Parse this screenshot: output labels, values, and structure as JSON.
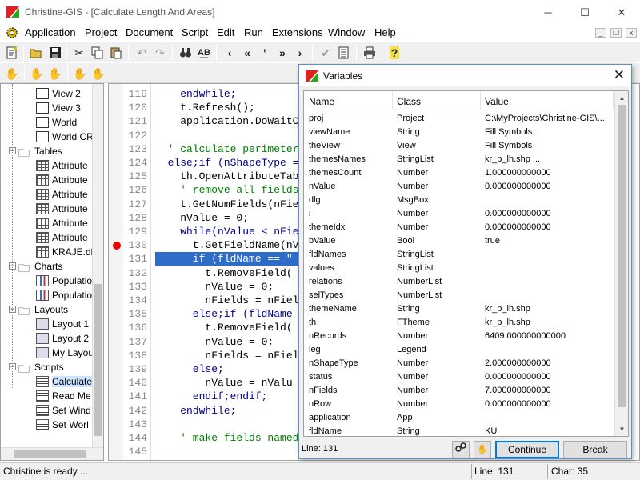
{
  "window": {
    "title": "Christine-GIS - [Calculate Length And Areas]",
    "minimize": "─",
    "maximize": "☐",
    "close": "✕"
  },
  "menu": {
    "items": [
      "Application",
      "Project",
      "Document",
      "Script",
      "Edit",
      "Run",
      "Extensions",
      "Window",
      "Help"
    ],
    "mdi_min": "_",
    "mdi_restore": "❐",
    "mdi_close": "x"
  },
  "toolbar1": {
    "icons": [
      "new-script-icon",
      "open-icon",
      "save-icon",
      "cut-icon",
      "copy-icon",
      "paste-icon",
      "undo-icon",
      "redo-icon",
      "find-icon",
      "replace-icon",
      "previous-icon",
      "first-icon",
      "quote-icon",
      "last-icon",
      "next-icon",
      "check-icon",
      "compile-icon",
      "print-icon",
      "help-icon"
    ]
  },
  "toolbar2": {
    "icons": [
      "hand-icon",
      "hand-step-icon",
      "hand-stop-icon",
      "hand-grid-icon",
      "hand-outline-icon"
    ]
  },
  "tree": {
    "rows": [
      {
        "label": "View 2",
        "icon": "doc"
      },
      {
        "label": "View 3",
        "icon": "doc"
      },
      {
        "label": "World",
        "icon": "doc"
      },
      {
        "label": "World CR",
        "icon": "doc"
      },
      {
        "label": "Tables",
        "icon": "folder"
      },
      {
        "label": "Attribute",
        "icon": "grid"
      },
      {
        "label": "Attribute",
        "icon": "grid"
      },
      {
        "label": "Attribute",
        "icon": "grid"
      },
      {
        "label": "Attribute",
        "icon": "grid"
      },
      {
        "label": "Attribute",
        "icon": "grid"
      },
      {
        "label": "Attribute",
        "icon": "grid"
      },
      {
        "label": "KRAJE.db",
        "icon": "grid"
      },
      {
        "label": "Charts",
        "icon": "folder"
      },
      {
        "label": "Populatio",
        "icon": "chart"
      },
      {
        "label": "Populatio",
        "icon": "chart"
      },
      {
        "label": "Layouts",
        "icon": "folder"
      },
      {
        "label": "Layout 1",
        "icon": "layout"
      },
      {
        "label": "Layout 2",
        "icon": "layout"
      },
      {
        "label": "My Layou",
        "icon": "layout"
      },
      {
        "label": "Scripts",
        "icon": "folder"
      },
      {
        "label": "Calculate",
        "icon": "script"
      },
      {
        "label": "Read Me",
        "icon": "script"
      },
      {
        "label": "Set Wind",
        "icon": "script"
      },
      {
        "label": "Set Worl",
        "icon": "script"
      }
    ]
  },
  "editor": {
    "lines": [
      {
        "n": "119",
        "text": "    endwhile;",
        "style": "kw"
      },
      {
        "n": "120",
        "text": "    t.Refresh();",
        "style": ""
      },
      {
        "n": "121",
        "text": "    application.DoWaitC",
        "style": ""
      },
      {
        "n": "122",
        "text": "",
        "style": ""
      },
      {
        "n": "123",
        "text": "  ' calculate perimeter",
        "style": "cm"
      },
      {
        "n": "124",
        "text": "  else;if (nShapeType =",
        "style": "kw"
      },
      {
        "n": "125",
        "text": "    th.OpenAttributeTab",
        "style": ""
      },
      {
        "n": "126",
        "text": "    ' remove all fields",
        "style": "cm"
      },
      {
        "n": "127",
        "text": "    t.GetNumFields(nFie",
        "style": ""
      },
      {
        "n": "128",
        "text": "    nValue = 0;",
        "style": ""
      },
      {
        "n": "129",
        "text": "    while(nValue < nFie",
        "style": "kw"
      },
      {
        "n": "130",
        "text": "      t.GetFieldName(nV",
        "style": ""
      },
      {
        "n": "131",
        "text": "      if (fldName == \"",
        "style": "hl"
      },
      {
        "n": "132",
        "text": "        t.RemoveField(",
        "style": ""
      },
      {
        "n": "133",
        "text": "        nValue = 0;",
        "style": ""
      },
      {
        "n": "134",
        "text": "        nFields = nFiel",
        "style": ""
      },
      {
        "n": "135",
        "text": "      else;if (fldName",
        "style": "kw"
      },
      {
        "n": "136",
        "text": "        t.RemoveField(",
        "style": ""
      },
      {
        "n": "137",
        "text": "        nValue = 0;",
        "style": ""
      },
      {
        "n": "138",
        "text": "        nFields = nFiel",
        "style": ""
      },
      {
        "n": "139",
        "text": "      else;",
        "style": "kw"
      },
      {
        "n": "140",
        "text": "        nValue = nValu",
        "style": ""
      },
      {
        "n": "141",
        "text": "      endif;endif;",
        "style": "kw"
      },
      {
        "n": "142",
        "text": "    endwhile;",
        "style": "kw"
      },
      {
        "n": "143",
        "text": "",
        "style": ""
      },
      {
        "n": "144",
        "text": "    ' make fields named",
        "style": "cm"
      },
      {
        "n": "145",
        "text": "",
        "style": ""
      }
    ],
    "breakpoint_line": "130"
  },
  "variables": {
    "title": "Variables",
    "close": "✕",
    "columns": [
      "Name",
      "Class",
      "Value"
    ],
    "rows": [
      [
        "proj",
        "Project",
        "C:\\MyProjects\\Christine-GIS\\..."
      ],
      [
        "viewName",
        "String",
        "Fill Symbols"
      ],
      [
        "theView",
        "View",
        "Fill Symbols"
      ],
      [
        "themesNames",
        "StringList",
        "kr_p_lh.shp ..."
      ],
      [
        "themesCount",
        "Number",
        "1.000000000000"
      ],
      [
        "nValue",
        "Number",
        "0.000000000000"
      ],
      [
        "dlg",
        "MsgBox",
        ""
      ],
      [
        "i",
        "Number",
        "0.000000000000"
      ],
      [
        "themeIdx",
        "Number",
        "0.000000000000"
      ],
      [
        "bValue",
        "Bool",
        "true"
      ],
      [
        "fldNames",
        "StringList",
        ""
      ],
      [
        "values",
        "StringList",
        ""
      ],
      [
        "relations",
        "NumberList",
        ""
      ],
      [
        "selTypes",
        "NumberList",
        ""
      ],
      [
        "themeName",
        "String",
        "kr_p_lh.shp"
      ],
      [
        "th",
        "FTheme",
        "kr_p_lh.shp"
      ],
      [
        "nRecords",
        "Number",
        "6409.000000000000"
      ],
      [
        "leg",
        "Legend",
        ""
      ],
      [
        "nShapeType",
        "Number",
        "2.000000000000"
      ],
      [
        "status",
        "Number",
        "0.000000000000"
      ],
      [
        "nFields",
        "Number",
        "7.000000000000"
      ],
      [
        "nRow",
        "Number",
        "0.000000000000"
      ],
      [
        "application",
        "App",
        ""
      ],
      [
        "fldName",
        "String",
        "KU"
      ]
    ],
    "line_label": "Line: 131",
    "continue_label": "Continue",
    "break_label": "Break"
  },
  "status": {
    "message": "Christine is ready ...",
    "line": "Line: 131",
    "char": "Char: 35"
  }
}
